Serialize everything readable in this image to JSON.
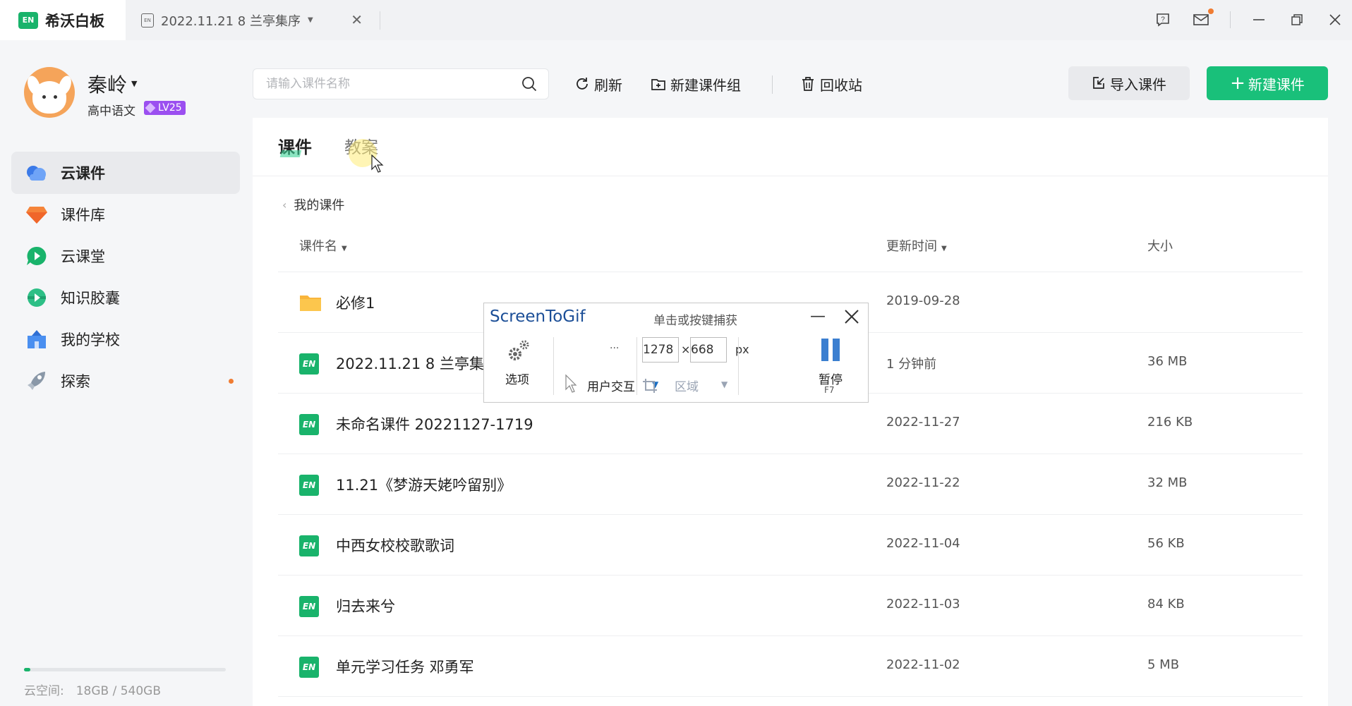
{
  "app": {
    "logo_text": "EN",
    "name": "希沃白板"
  },
  "tab": {
    "label": "2022.11.21 8 兰亭集序"
  },
  "user": {
    "name": "秦岭",
    "subject": "高中语文",
    "level": "LV25"
  },
  "nav": {
    "items": [
      {
        "label": "云课件",
        "icon": "cloud-icon"
      },
      {
        "label": "课件库",
        "icon": "gem-icon"
      },
      {
        "label": "云课堂",
        "icon": "play-bubble-icon"
      },
      {
        "label": "知识胶囊",
        "icon": "capsule-icon"
      },
      {
        "label": "我的学校",
        "icon": "school-icon"
      },
      {
        "label": "探索",
        "icon": "rocket-icon"
      }
    ]
  },
  "storage": {
    "text": "云空间:　18GB / 540GB",
    "used_fraction": 0.033
  },
  "toolbar": {
    "search_placeholder": "请输入课件名称",
    "refresh_label": "刷新",
    "new_group_label": "新建课件组",
    "recycle_label": "回收站",
    "import_label": "导入课件",
    "new_label": "新建课件"
  },
  "content": {
    "tabs": [
      "课件",
      "教案"
    ],
    "breadcrumb": "我的课件",
    "columns": {
      "name": "课件名",
      "updated": "更新时间",
      "size": "大小"
    },
    "rows": [
      {
        "name": "必修1",
        "date": "2019-09-28",
        "size": "",
        "type": "folder"
      },
      {
        "name": "2022.11.21 8 兰亭集序",
        "date": "1 分钟前",
        "size": "36 MB",
        "type": "file"
      },
      {
        "name": "未命名课件 20221127-1719",
        "date": "2022-11-27",
        "size": "216 KB",
        "type": "file"
      },
      {
        "name": "11.21《梦游天姥吟留别》",
        "date": "2022-11-22",
        "size": "32 MB",
        "type": "file"
      },
      {
        "name": "中西女校校歌歌词",
        "date": "2022-11-04",
        "size": "56 KB",
        "type": "file"
      },
      {
        "name": "归去来兮",
        "date": "2022-11-03",
        "size": "84 KB",
        "type": "file"
      },
      {
        "name": "单元学习任务 邓勇军",
        "date": "2022-11-02",
        "size": "5 MB",
        "type": "file"
      }
    ]
  },
  "screentogif": {
    "title": "ScreenToGif",
    "hint": "单击或按键捕获",
    "options_label": "选项",
    "dots": "...",
    "mode_label": "用户交互",
    "width": "1278",
    "height": "668",
    "x_sep": "×",
    "unit": "px",
    "area_label": "区域",
    "pause_label": "暂停",
    "pause_key": "F7"
  },
  "colors": {
    "brand_green": "#19c07a",
    "badge_purple": "#9b4ff0",
    "notification_orange": "#f07c32",
    "stg_blue": "#1b4e97"
  }
}
